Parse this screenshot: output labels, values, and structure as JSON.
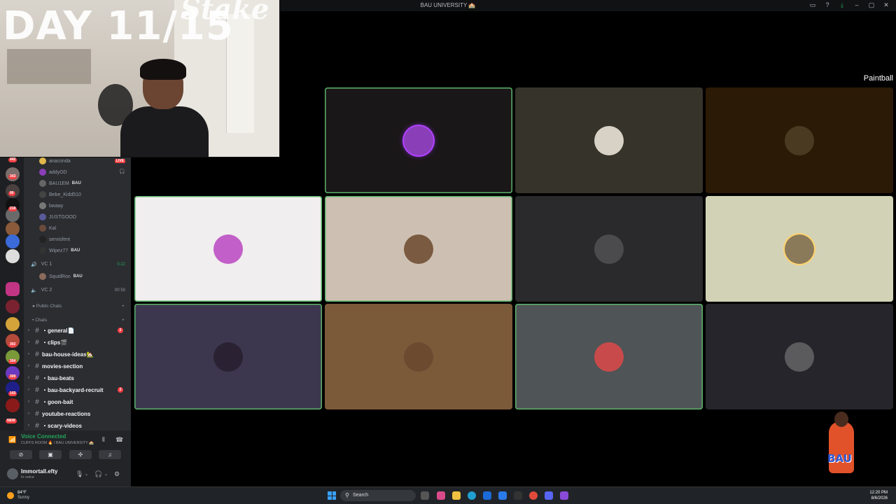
{
  "window": {
    "title": "BAU UNIVERSITY",
    "title_emoji": "🏫",
    "controls": [
      "inbox-icon",
      "help-icon",
      "download-icon",
      "minimize-icon",
      "maximize-icon",
      "close-icon"
    ]
  },
  "overlay": {
    "day_counter": "DAY 11/15",
    "brand": "Stake"
  },
  "servers": {
    "badges": [
      "442",
      "343",
      "90",
      "218",
      "16",
      "302",
      "394",
      "309",
      "143",
      "NEW"
    ]
  },
  "voice_channel": {
    "users": [
      {
        "name": "anaconda",
        "live": "LIVE"
      },
      {
        "name": "addyOD"
      },
      {
        "name": "BAU1EM",
        "tag": "BAU"
      },
      {
        "name": "Bebe_Kidd510"
      },
      {
        "name": "bwaay"
      },
      {
        "name": "JUSTGOOD"
      },
      {
        "name": "Kal"
      },
      {
        "name": "servisfent"
      },
      {
        "name": "Wipez77",
        "tag": "BAU"
      }
    ],
    "vc1": {
      "name": "VC 1",
      "time": "0:22",
      "user": "SquidRon",
      "user_tag": "BAU"
    },
    "vc2": {
      "name": "VC 2",
      "count": "00 50"
    }
  },
  "categories": {
    "public_chats": "Public Chats",
    "chats": "Chats"
  },
  "channels": [
    {
      "name": "general",
      "emoji": "📄",
      "prefix": "・",
      "badge": "2"
    },
    {
      "name": "clips",
      "emoji": "🎬",
      "prefix": "・"
    },
    {
      "name": "bau-house-ideas",
      "emoji": "🏡",
      "prefix": ""
    },
    {
      "name": "movies-section",
      "prefix": ""
    },
    {
      "name": "bau-beats",
      "prefix": "・"
    },
    {
      "name": "bau-backyard-recruit",
      "prefix": "・",
      "badge": "2"
    },
    {
      "name": "goon-bait",
      "prefix": "・"
    },
    {
      "name": "youtube-reactions",
      "prefix": ""
    },
    {
      "name": "scary-videos",
      "prefix": "・"
    }
  ],
  "voice_bar": {
    "status": "Voice Connected",
    "location": "CUFFS ROOM 🔥 / BAU UNIVERSITY 🏫"
  },
  "user_panel": {
    "name": "Immortall.efty",
    "status": "In voice"
  },
  "stage": {
    "activity_label": "Paintball",
    "tiles": [
      {
        "bg": "#000000",
        "speaking": false,
        "pfp": "none"
      },
      {
        "bg": "#1a1718",
        "speaking": true,
        "pfp": "#8a3fb8",
        "ring": true
      },
      {
        "bg": "#36332a",
        "speaking": false,
        "pfp": "#d8d2c6"
      },
      {
        "bg": "#2b1a06",
        "speaking": false,
        "pfp": "#4a3a22"
      },
      {
        "bg": "#f0eeee",
        "speaking": true,
        "pfp": "#c25fc8"
      },
      {
        "bg": "#cdc0b2",
        "speaking": true,
        "pfp": "#7a5a40"
      },
      {
        "bg": "#2a292c",
        "speaking": false,
        "pfp": "#4b4b4d"
      },
      {
        "bg": "#d2d2b6",
        "speaking": false,
        "pfp": "#8b7a5a",
        "gold": true
      },
      {
        "bg": "#3c374e",
        "speaking": true,
        "pfp": "#2a2233"
      },
      {
        "bg": "#7b5a3a",
        "speaking": false,
        "pfp": "#6b4a30"
      },
      {
        "bg": "#4f5456",
        "speaking": true,
        "pfp": "#c94a4a"
      },
      {
        "bg": "#25252b",
        "speaking": false,
        "pfp": "#5b5b5d"
      }
    ]
  },
  "sticker": {
    "text": "BAU"
  },
  "taskbar": {
    "temp": "84°F",
    "condition": "Sunny",
    "search_placeholder": "Search",
    "time": "12:20 PM",
    "date": "8/6/2026"
  }
}
